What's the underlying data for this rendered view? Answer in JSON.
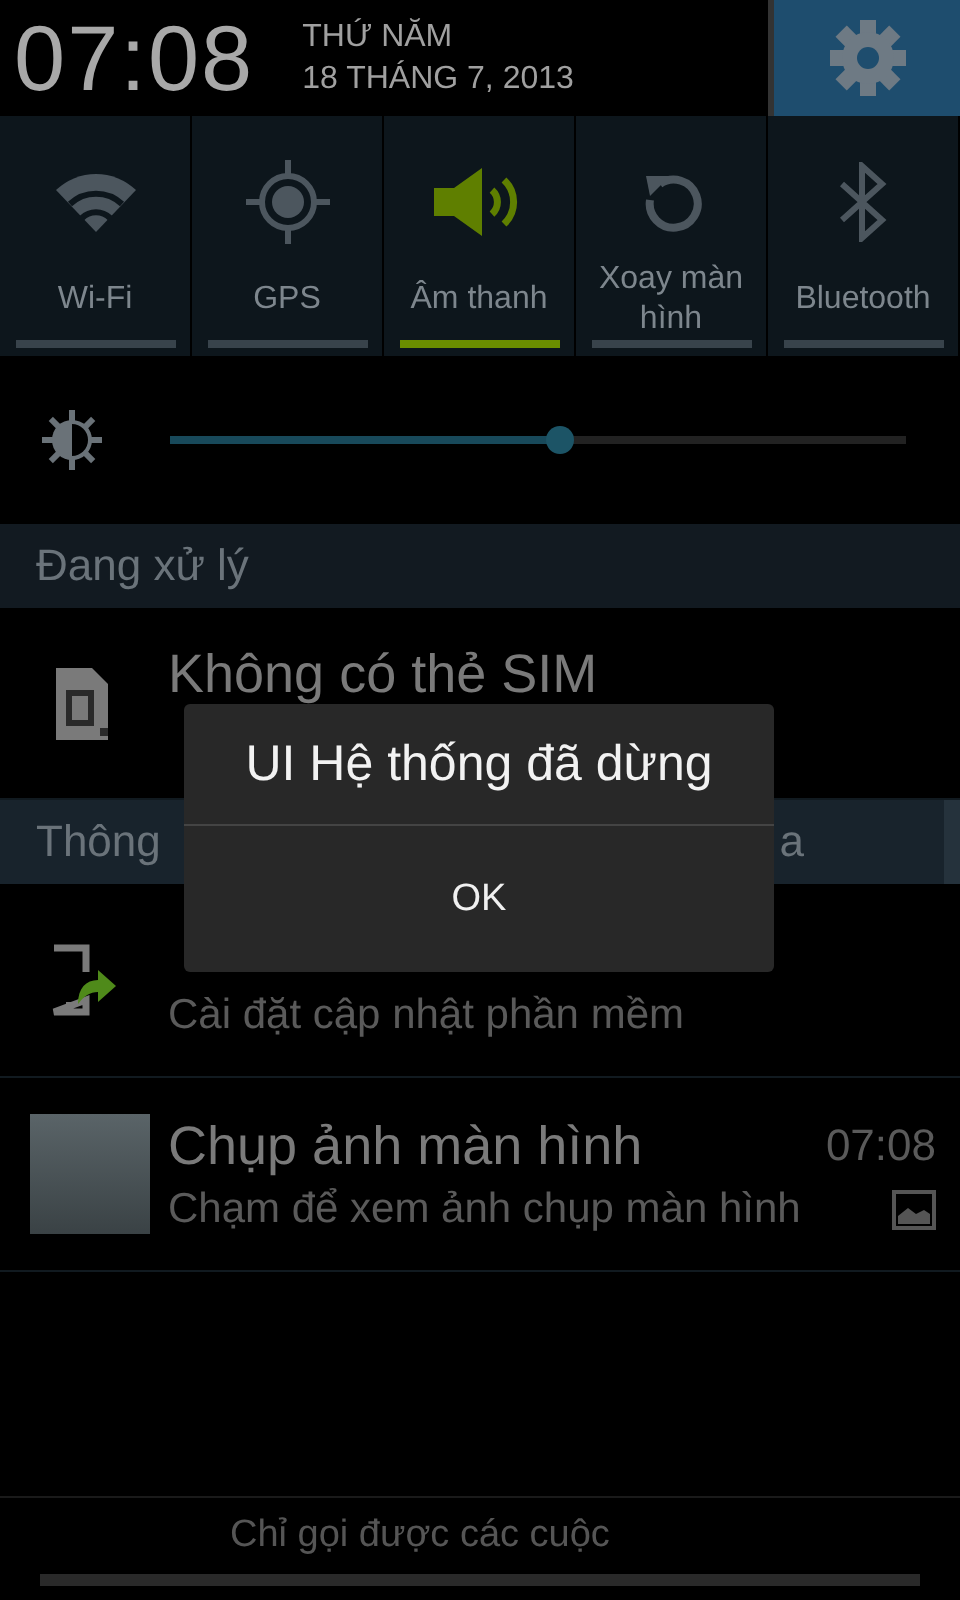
{
  "clock": {
    "time": "07:08",
    "weekday": "THỨ NĂM",
    "date": "18 THÁNG 7, 2013"
  },
  "toggles": [
    {
      "kind": "wifi",
      "label": "Wi-Fi",
      "on": false
    },
    {
      "kind": "gps",
      "label": "GPS",
      "on": false
    },
    {
      "kind": "sound",
      "label": "Âm thanh",
      "on": true
    },
    {
      "kind": "rotate",
      "label": "Xoay màn hình",
      "on": false
    },
    {
      "kind": "bluetooth",
      "label": "Bluetooth",
      "on": false
    }
  ],
  "brightness": {
    "level": 0.53
  },
  "ongoing": {
    "header": "Đang xử lý",
    "notification": {
      "kind": "sim",
      "title": "Không có thẻ SIM"
    }
  },
  "notifications_section": {
    "header": "Thông",
    "clear_button": "a"
  },
  "notifications": [
    {
      "kind": "update",
      "subtitle": "Cài đặt cập nhật phần mềm"
    },
    {
      "kind": "screenshot",
      "title": "Chụp ảnh màn hình",
      "time": "07:08",
      "subtitle": "Chạm để xem ảnh chụp màn hình"
    }
  ],
  "footer": {
    "carrier_text": "Chỉ gọi được các cuộc"
  },
  "dialog": {
    "title": "UI Hệ thống đã dừng",
    "button": "OK"
  }
}
